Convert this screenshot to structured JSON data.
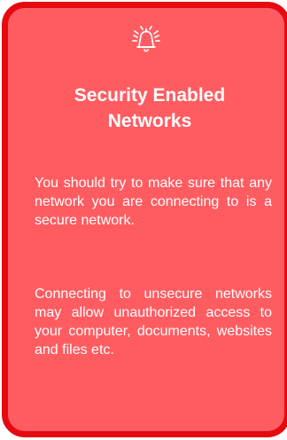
{
  "card": {
    "icon": "bell-alert-icon",
    "title_line1": "Security Enabled",
    "title_line2": "Networks",
    "paragraphs": [
      "You should try to make sure that any network you are connecting to is a se­cure network.",
      "Connecting to unsecure net­works may allow unautho­rized access to your computer, documents, web­sites and files etc."
    ]
  },
  "colors": {
    "border": "#e50a10",
    "background": "#ff5c61",
    "text": "#ffffff"
  }
}
